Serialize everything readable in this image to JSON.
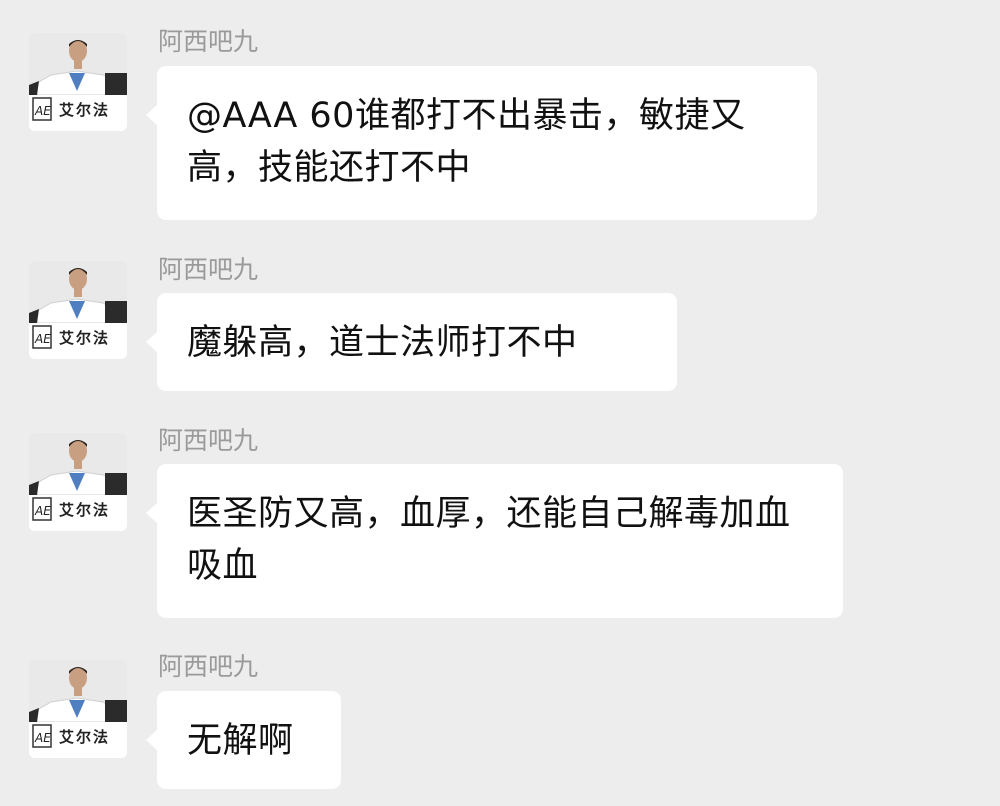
{
  "chat": {
    "messages": [
      {
        "sender": "阿西吧九",
        "avatar_brand": "艾尔法",
        "avatar_icon": "avatar-man-in-white-suit",
        "text": "@AAA 60谁都打不出暴击，敏捷又高，技能还打不中"
      },
      {
        "sender": "阿西吧九",
        "avatar_brand": "艾尔法",
        "avatar_icon": "avatar-man-in-white-suit",
        "text": "魔躲高，道士法师打不中"
      },
      {
        "sender": "阿西吧九",
        "avatar_brand": "艾尔法",
        "avatar_icon": "avatar-man-in-white-suit",
        "text": "医圣防又高，血厚，还能自己解毒加血吸血"
      },
      {
        "sender": "阿西吧九",
        "avatar_brand": "艾尔法",
        "avatar_icon": "avatar-man-in-white-suit",
        "text": "无解啊"
      }
    ]
  },
  "colors": {
    "background": "#ededed",
    "bubble": "#ffffff",
    "sender_name": "#9a9a9a",
    "message_text": "#111111"
  }
}
